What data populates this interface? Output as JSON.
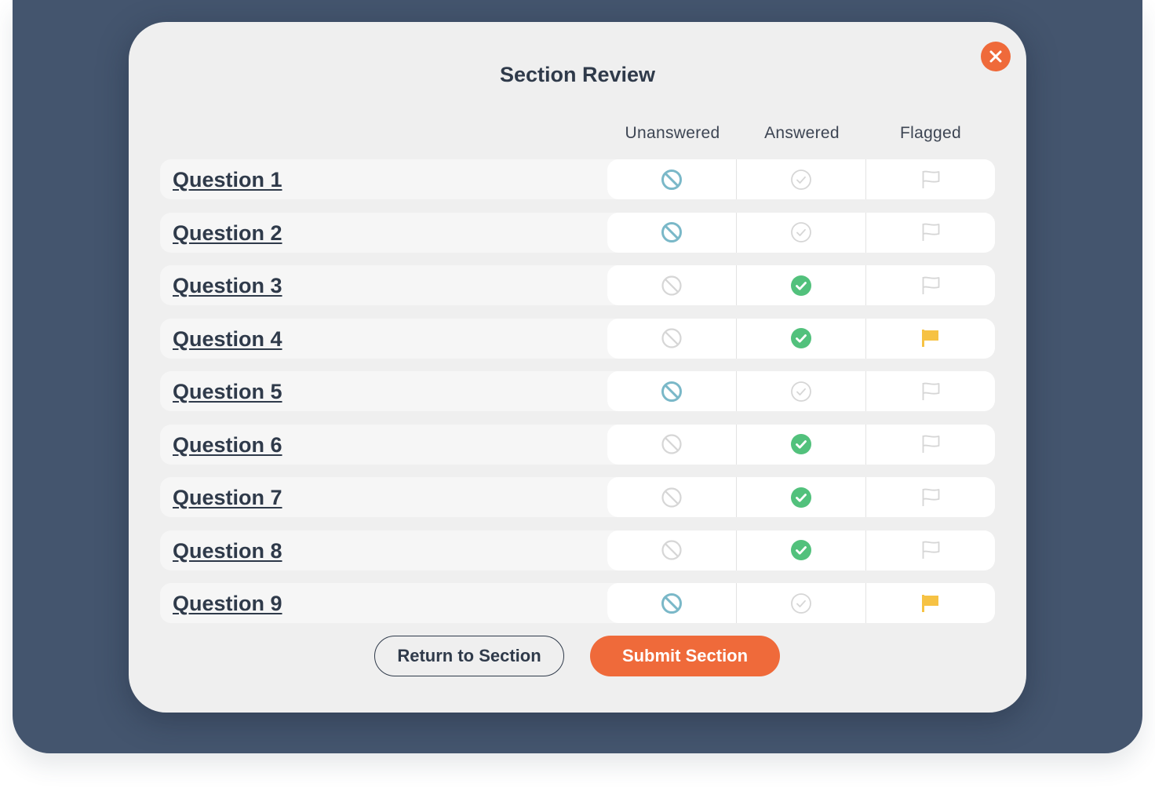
{
  "dialog": {
    "title": "Section Review",
    "close_icon": "close-x-icon",
    "accent_color": "#ef6a3a"
  },
  "columns": {
    "unanswered": "Unanswered",
    "answered": "Answered",
    "flagged": "Flagged"
  },
  "status_colors": {
    "unanswered_active": "#7ab8c8",
    "answered_active": "#52c17c",
    "flagged_active": "#f6c244",
    "inactive": "#d6d6d6"
  },
  "questions": [
    {
      "label": "Question 1",
      "unanswered": true,
      "answered": false,
      "flagged": false
    },
    {
      "label": "Question 2",
      "unanswered": true,
      "answered": false,
      "flagged": false
    },
    {
      "label": "Question 3",
      "unanswered": false,
      "answered": true,
      "flagged": false
    },
    {
      "label": "Question 4",
      "unanswered": false,
      "answered": true,
      "flagged": true
    },
    {
      "label": "Question 5",
      "unanswered": true,
      "answered": false,
      "flagged": false
    },
    {
      "label": "Question 6",
      "unanswered": false,
      "answered": true,
      "flagged": false
    },
    {
      "label": "Question 7",
      "unanswered": false,
      "answered": true,
      "flagged": false
    },
    {
      "label": "Question 8",
      "unanswered": false,
      "answered": true,
      "flagged": false
    },
    {
      "label": "Question 9",
      "unanswered": true,
      "answered": false,
      "flagged": true
    }
  ],
  "actions": {
    "return_label": "Return to Section",
    "submit_label": "Submit Section"
  }
}
